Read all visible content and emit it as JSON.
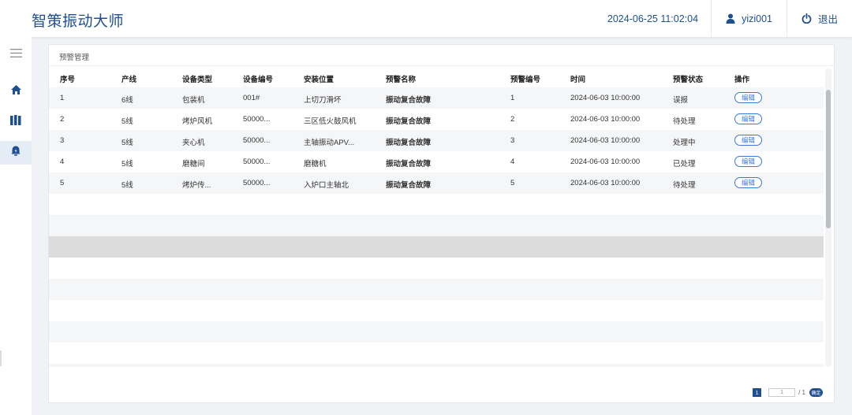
{
  "header": {
    "title": "智策振动大师",
    "datetime": "2024-06-25 11:02:04",
    "username": "yizi001",
    "logout_label": "退出"
  },
  "sidebar": {
    "items": [
      {
        "name": "menu",
        "icon": "hamburger-icon"
      },
      {
        "name": "home",
        "icon": "home-icon"
      },
      {
        "name": "books",
        "icon": "book-icon"
      },
      {
        "name": "alarm",
        "icon": "alarm-bell-icon"
      }
    ],
    "active": "alarm"
  },
  "panel": {
    "title": "预警管理"
  },
  "table": {
    "columns": [
      "序号",
      "产线",
      "设备类型",
      "设备编号",
      "安装位置",
      "预警名称",
      "预警编号",
      "时间",
      "预警状态",
      "操作"
    ],
    "rows": [
      [
        "1",
        "6线",
        "包装机",
        "001#",
        "上切刀滑坏",
        "振动复合故障",
        "1",
        "2024-06-03 10:00:00",
        "误报",
        "编辑"
      ],
      [
        "2",
        "5线",
        "烤炉风机",
        "50000...",
        "三区低火鼓风机",
        "振动复合故障",
        "2",
        "2024-06-03 10:00:00",
        "待处理",
        "编辑"
      ],
      [
        "3",
        "5线",
        "夹心机",
        "50000...",
        "主轴振动APV...",
        "振动复合故障",
        "3",
        "2024-06-03 10:00:00",
        "处理中",
        "编辑"
      ],
      [
        "4",
        "5线",
        "磨糖间",
        "50000...",
        "磨糖机",
        "振动复合故障",
        "4",
        "2024-06-03 10:00:00",
        "已处理",
        "编辑"
      ],
      [
        "5",
        "5线",
        "烤炉传...",
        "50000...",
        "入炉口主轴北",
        "振动复合故障",
        "5",
        "2024-06-03 10:00:00",
        "待处理",
        "编辑"
      ]
    ]
  },
  "pagination": {
    "current_page": "1",
    "input_value": "1",
    "total_label": "/ 1",
    "confirm_label": "确定"
  },
  "colors": {
    "brand": "#1d4f91",
    "link": "#3b78d8"
  }
}
